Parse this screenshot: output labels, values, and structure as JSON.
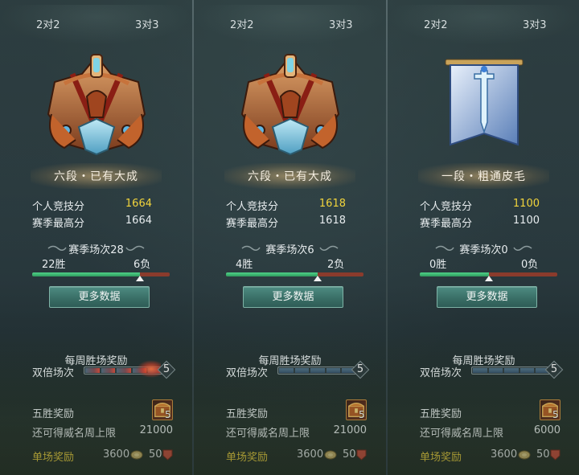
{
  "tabs": {
    "two_v_two": "2对2",
    "three_v_three": "3对3"
  },
  "labels": {
    "personal_score": "个人竞技分",
    "season_high": "赛季最高分",
    "more_data": "更多数据",
    "weekly_reward": "每周胜场奖励",
    "double_matches": "双倍场次",
    "five_win_reward": "五胜奖励",
    "fame_limit": "还可得威名周上限",
    "single_match_reward": "单场奖励"
  },
  "panels": [
    {
      "rank": "六段・已有大成",
      "emblem": "bronze-crest-emblem-icon",
      "personal_score": "1664",
      "season_high": "1664",
      "season_matches": "赛季场次28",
      "wins": "22胜",
      "losses": "6负",
      "win_fraction": 0.786,
      "double_count": "5",
      "double_hot": true,
      "chest_count": "5",
      "fame_limit": "21000",
      "coin_reward": "3600",
      "medal_reward": "50"
    },
    {
      "rank": "六段・已有大成",
      "emblem": "bronze-crest-emblem-icon",
      "personal_score": "1618",
      "season_high": "1618",
      "season_matches": "赛季场次6",
      "wins": "4胜",
      "losses": "2负",
      "win_fraction": 0.667,
      "double_count": "5",
      "double_hot": false,
      "chest_count": "5",
      "fame_limit": "21000",
      "coin_reward": "3600",
      "medal_reward": "50"
    },
    {
      "rank": "一段・粗通皮毛",
      "emblem": "blue-banner-sword-emblem-icon",
      "personal_score": "1100",
      "season_high": "1100",
      "season_matches": "赛季场次0",
      "wins": "0胜",
      "losses": "0负",
      "win_fraction": 0.5,
      "double_count": "5",
      "double_hot": false,
      "chest_count": "5",
      "fame_limit": "6000",
      "coin_reward": "3600",
      "medal_reward": "50"
    }
  ],
  "colors": {
    "score_gold": "#f1d43c",
    "win_green": "#3fbf77",
    "loss_red": "#b24a32",
    "button_teal": "#3a6f67"
  }
}
